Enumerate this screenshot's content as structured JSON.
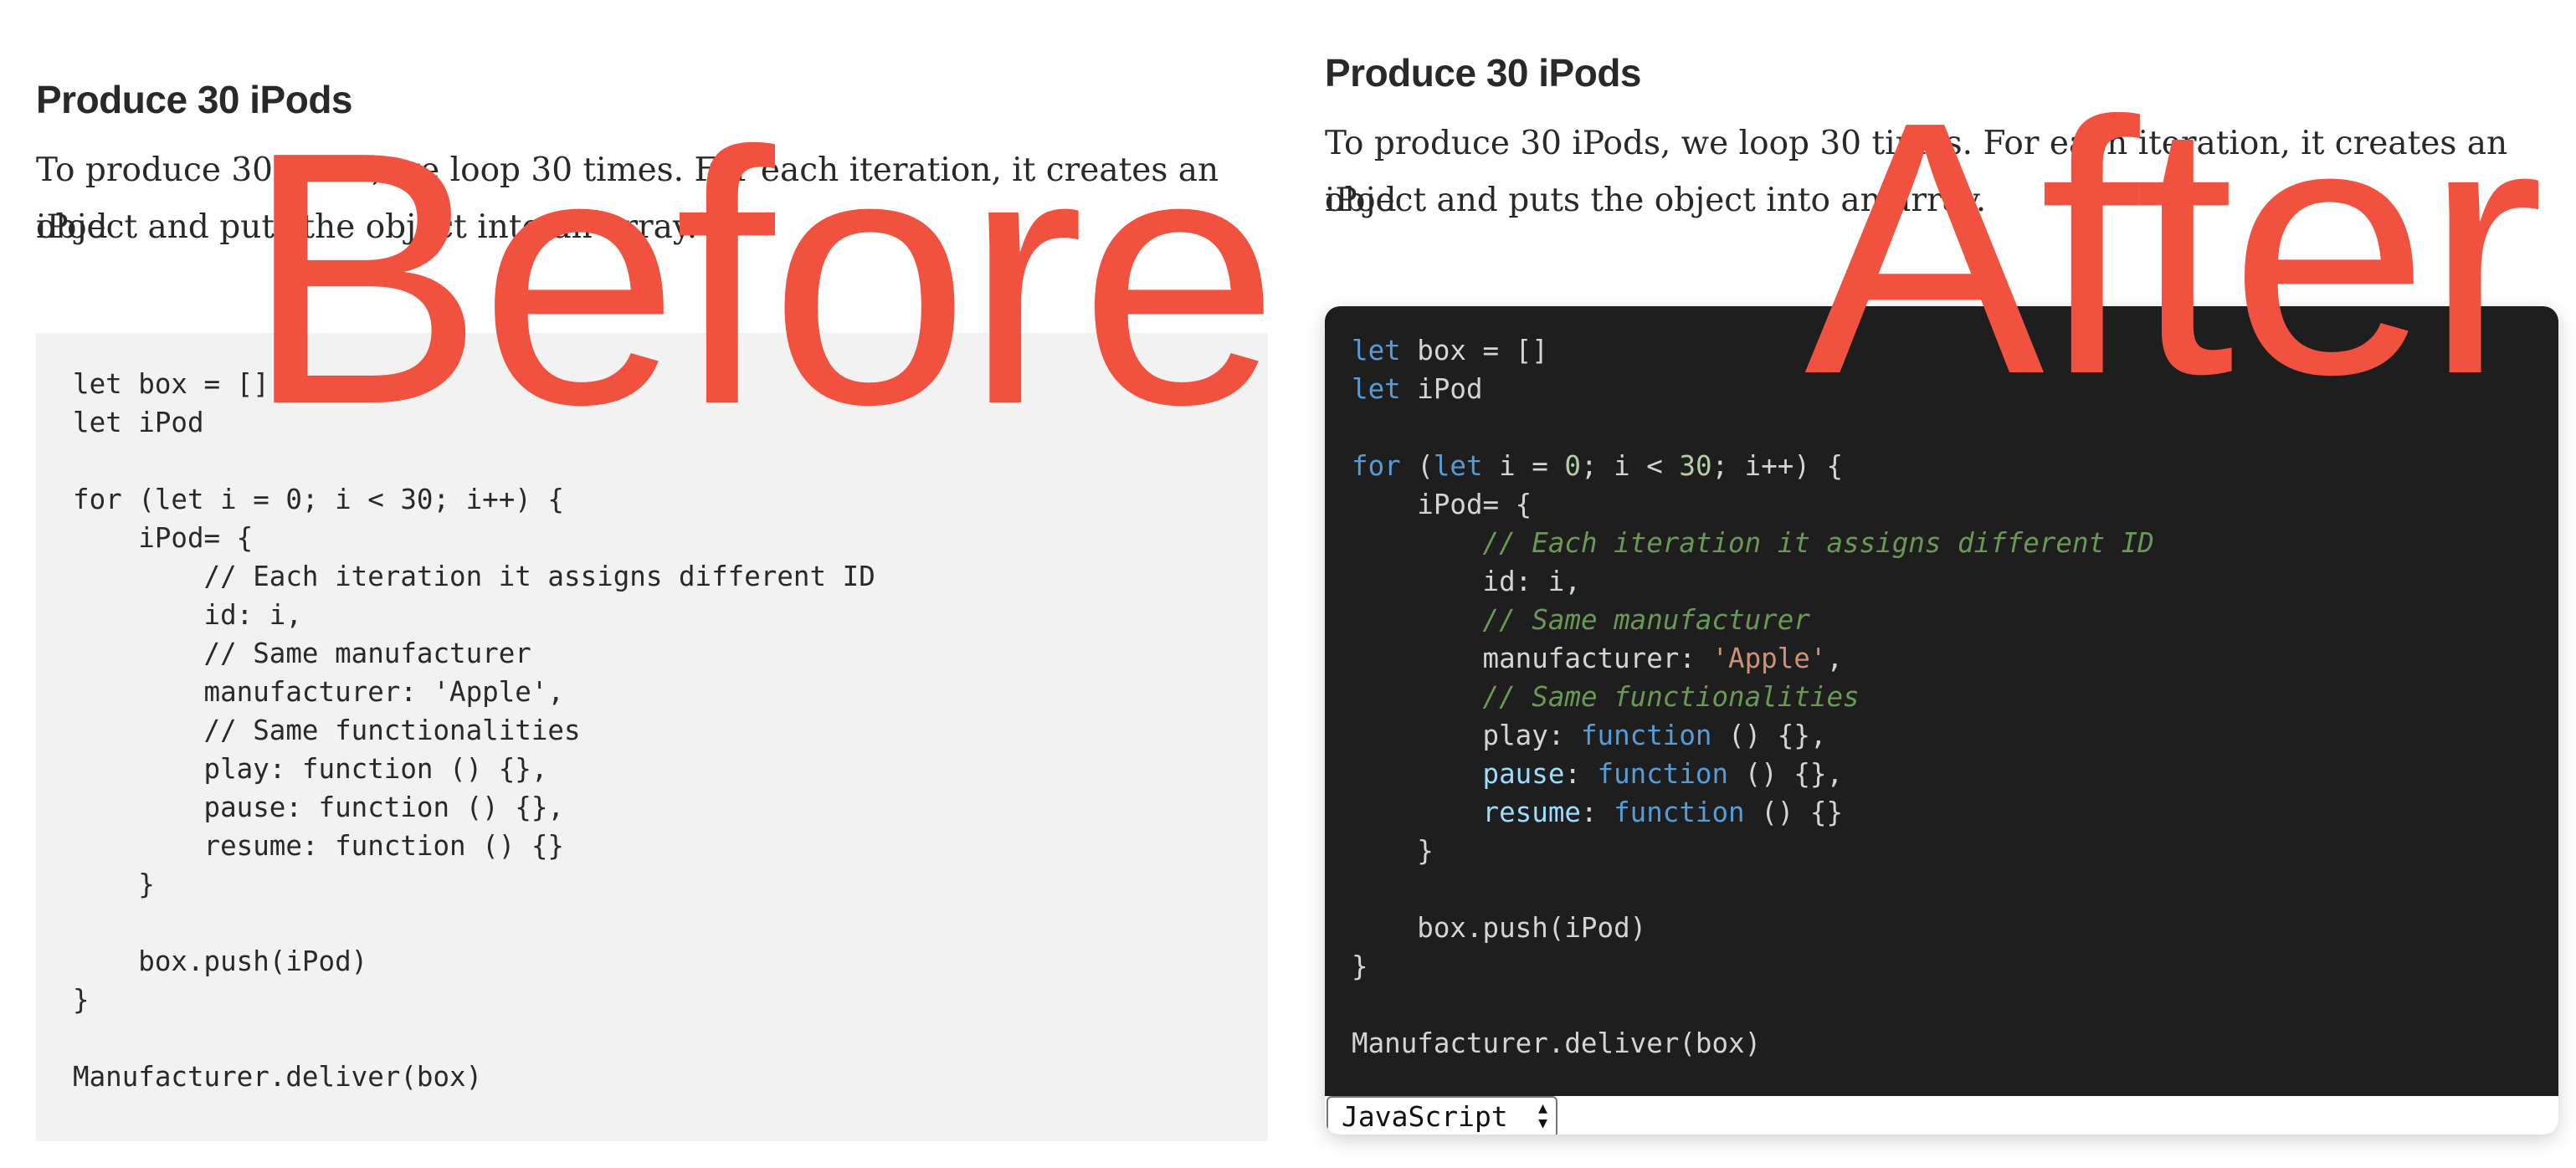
{
  "before": {
    "heading": "Produce 30 iPods",
    "paragraph_line1": "To produce 30 iPods, we loop 30 times. For each iteration, it creates an iPod",
    "paragraph_line2": "object and puts the object into an array.",
    "code": "let box = []\nlet iPod\n\nfor (let i = 0; i < 30; i++) {\n    iPod= {\n        // Each iteration it assigns different ID\n        id: i,\n        // Same manufacturer\n        manufacturer: 'Apple',\n        // Same functionalities\n        play: function () {},\n        pause: function () {},\n        resume: function () {}\n    }\n\n    box.push(iPod)\n}\n\nManufacturer.deliver(box)"
  },
  "after": {
    "heading": "Produce 30 iPods",
    "paragraph_line1": "To produce 30 iPods, we loop 30 times. For each iteration, it creates an iPod",
    "paragraph_line2": "object and puts the object into an array.",
    "code_lines": {
      "l1_kw": "let",
      "l1_rest": " box = []",
      "l2_kw": "let",
      "l2_rest": " iPod",
      "l4_for": "for",
      "l4_a": " (",
      "l4_let": "let",
      "l4_b": " i = ",
      "l4_zero": "0",
      "l4_c": "; i < ",
      "l4_thirty": "30",
      "l4_d": "; i++) {",
      "l5": "    iPod= {",
      "l6_indent": "        ",
      "l6_comment": "// Each iteration it assigns different ID",
      "l7": "        id: i,",
      "l8_indent": "        ",
      "l8_comment": "// Same manufacturer",
      "l9_a": "        manufacturer: ",
      "l9_str": "'Apple'",
      "l9_b": ",",
      "l10_indent": "        ",
      "l10_comment": "// Same functionalities",
      "l11_a": "        play: ",
      "l11_fn": "function",
      "l11_b": " () {},",
      "l12_indent": "        ",
      "l12_prop": "pause",
      "l12_a": ": ",
      "l12_fn": "function",
      "l12_b": " () {},",
      "l13_indent": "        ",
      "l13_prop": "resume",
      "l13_a": ": ",
      "l13_fn": "function",
      "l13_b": " () {}",
      "l14": "    }",
      "l16": "    box.push(iPod)",
      "l17": "}",
      "l19": "Manufacturer.deliver(box)"
    },
    "language_select": "JavaScript",
    "select_arrow_up": "▲",
    "select_arrow_down": "▼"
  },
  "labels": {
    "before": "Before",
    "after": "After"
  },
  "colors": {
    "label_red": "#f0523f",
    "code_bg_dark": "#1e1e1e",
    "code_bg_light": "#f2f2f2",
    "keyword": "#569cd6",
    "comment": "#6a9955",
    "string": "#ce9178",
    "number": "#b5cea8"
  }
}
